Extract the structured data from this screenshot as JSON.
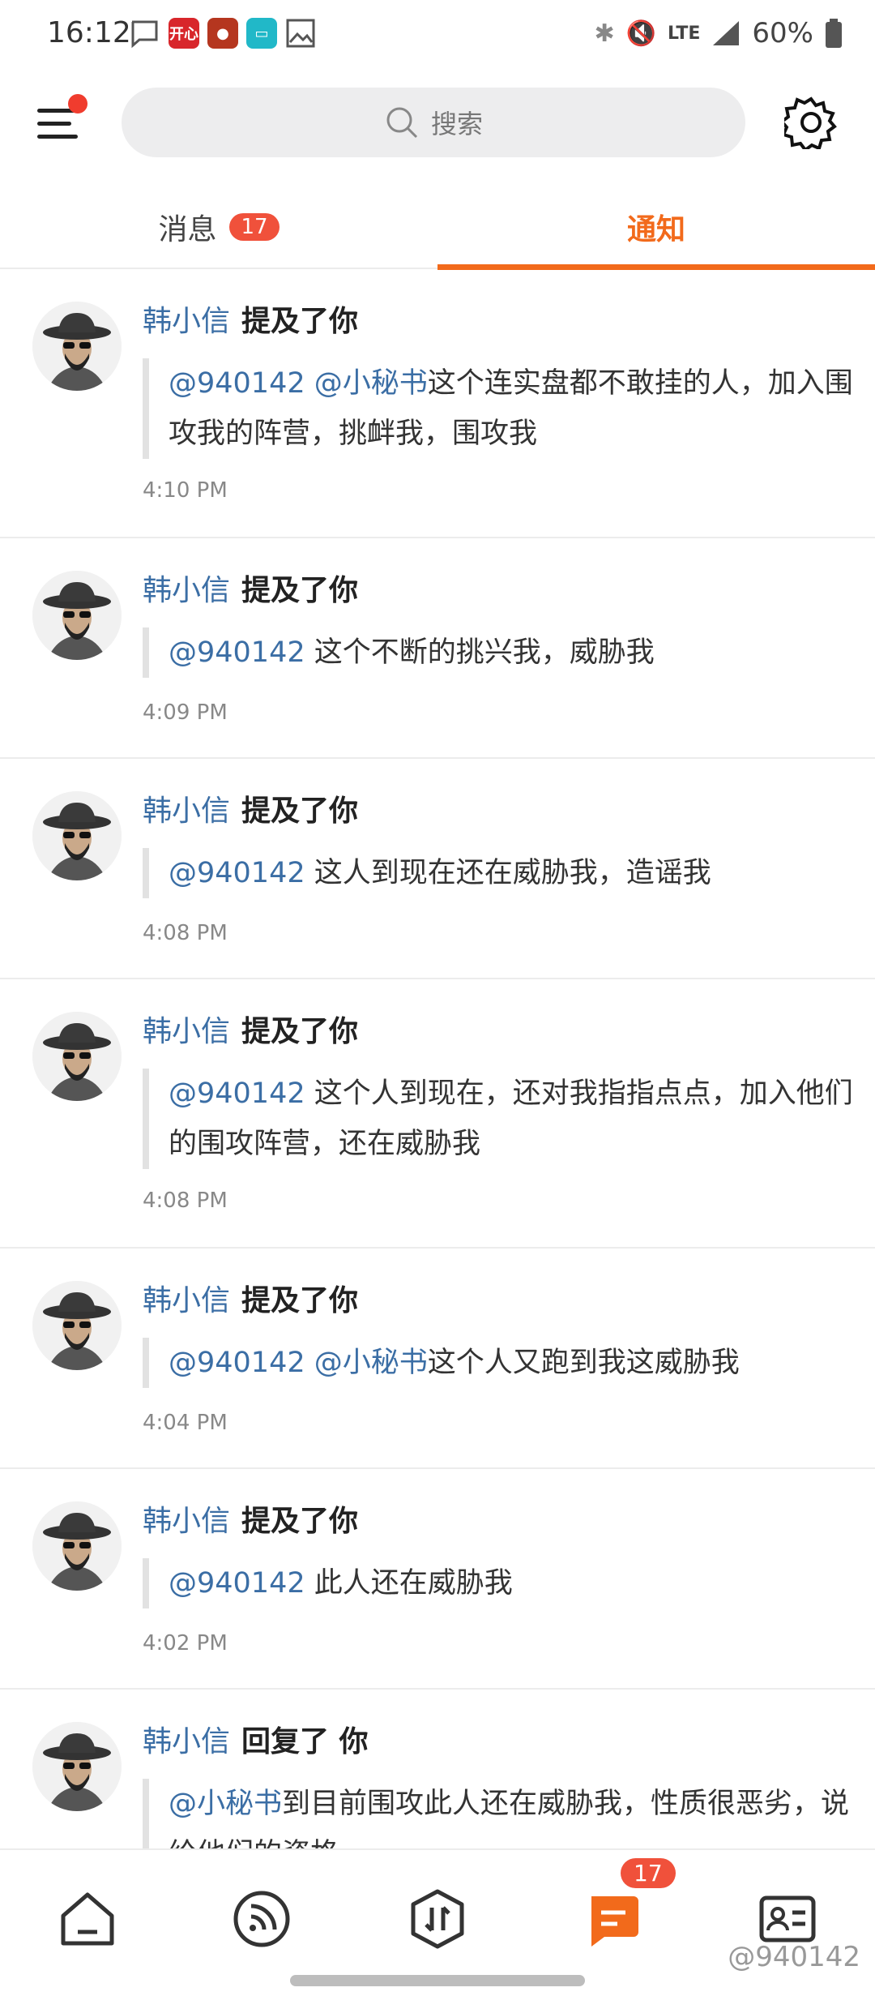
{
  "status_bar": {
    "time": "16:12",
    "app_icon_1": "开心",
    "network": "LTE",
    "battery": "60%"
  },
  "search": {
    "placeholder": "搜索"
  },
  "tabs": {
    "messages": {
      "label": "消息",
      "badge": "17"
    },
    "notices": {
      "label": "通知"
    }
  },
  "notifications": [
    {
      "user": "韩小信",
      "action": "提及了你",
      "mentions": "@940142 @小秘书",
      "text": "这个连实盘都不敢挂的人，加入围攻我的阵营，挑衅我，围攻我",
      "time": "4:10 PM"
    },
    {
      "user": "韩小信",
      "action": "提及了你",
      "mentions": "@940142",
      "text": " 这个不断的挑兴我，威胁我",
      "time": "4:09 PM"
    },
    {
      "user": "韩小信",
      "action": "提及了你",
      "mentions": "@940142",
      "text": " 这人到现在还在威胁我，造谣我",
      "time": "4:08 PM"
    },
    {
      "user": "韩小信",
      "action": "提及了你",
      "mentions": "@940142",
      "text": " 这个人到现在，还对我指指点点，加入他们的围攻阵营，还在威胁我",
      "time": "4:08 PM"
    },
    {
      "user": "韩小信",
      "action": "提及了你",
      "mentions": "@940142 @小秘书",
      "text": "这个人又跑到我这威胁我",
      "time": "4:04 PM"
    },
    {
      "user": "韩小信",
      "action": "提及了你",
      "mentions": "@940142",
      "text": " 此人还在威胁我",
      "time": "4:02 PM"
    },
    {
      "user": "韩小信",
      "action": "回复了 你",
      "mentions": "@小秘书",
      "text": "到目前围攻此人还在威胁我，性质很恶劣，说给他们的资格",
      "time": ""
    }
  ],
  "bottom_nav": {
    "items": [
      "home-icon",
      "feed-icon",
      "trade-icon",
      "messages-icon",
      "profile-card-icon"
    ],
    "active": "messages-icon",
    "badge": "17",
    "accent": "#f26a1b"
  },
  "watermark": "@940142"
}
